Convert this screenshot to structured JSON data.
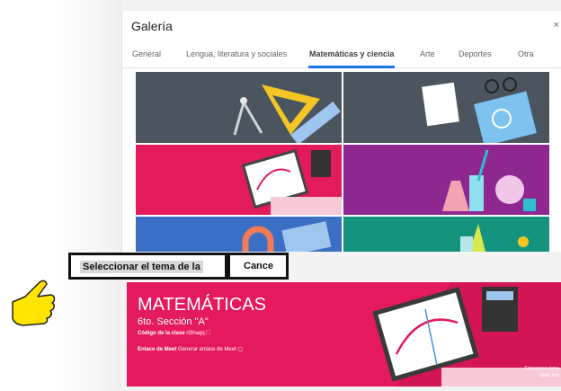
{
  "dialog": {
    "title": "Galería",
    "close_glyph": "×",
    "tabs": [
      {
        "label": "General",
        "active": false
      },
      {
        "label": "Lengua, literatura y sociales",
        "active": false
      },
      {
        "label": "Matemáticas y ciencia",
        "active": true
      },
      {
        "label": "Arte",
        "active": false
      },
      {
        "label": "Deportes",
        "active": false
      },
      {
        "label": "Otra",
        "active": false
      }
    ],
    "theme_tiles": [
      {
        "icon": "geometry-tools-icon",
        "color": "#4a5560"
      },
      {
        "icon": "brain-notebook-icon",
        "color": "#4a5560"
      },
      {
        "icon": "graph-tablet-icon",
        "color": "#e31b5b"
      },
      {
        "icon": "chemistry-flasks-icon",
        "color": "#8e2790"
      },
      {
        "icon": "magnet-icon",
        "color": "#3b6fc4"
      },
      {
        "icon": "plants-icon",
        "color": "#14937f"
      }
    ]
  },
  "annotations": {
    "select_label": "Seleccionar el tema de la",
    "cancel_label": "Cance"
  },
  "banner": {
    "title": "MATEMÁTICAS",
    "subtitle": "6to. Sección \"A\"",
    "code_label": "Código de la clase",
    "code_value": "rt3haqq",
    "meet_label": "Enlace de Meet",
    "meet_value": "Generar enlace de Meet",
    "select_theme": "Seleccionar tema",
    "upload_photo": "Subir foto",
    "color": "#e5195f"
  },
  "pointer": {
    "icon": "pointing-hand-icon",
    "color": "#ffe400"
  }
}
